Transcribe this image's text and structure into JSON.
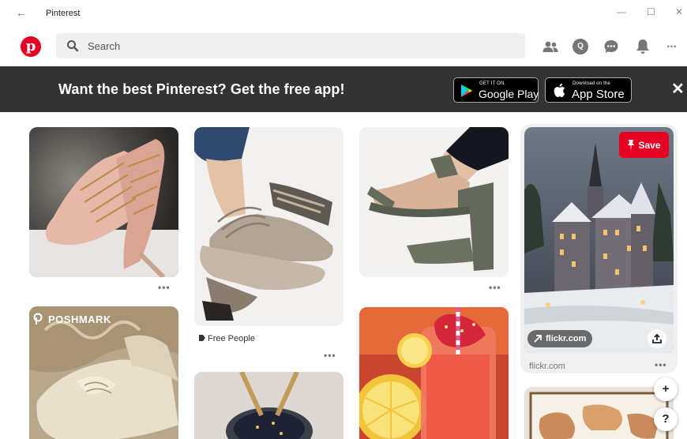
{
  "window": {
    "title": "Pinterest",
    "back_glyph": "←",
    "minimize_glyph": "—",
    "maximize_glyph": "☐",
    "close_glyph": "✕"
  },
  "header": {
    "logo_letter": "p",
    "search": {
      "placeholder": "Search",
      "value": ""
    },
    "notifications_avatar_letter": "Q",
    "more_glyph": "•••"
  },
  "banner": {
    "text": "Want the best Pinterest? Get the free app!",
    "google_play": {
      "small": "GET IT ON",
      "big": "Google Play"
    },
    "app_store": {
      "small": "Download on the",
      "big": "App Store"
    },
    "close_glyph": "✕"
  },
  "pins": {
    "dots": "•••",
    "free_people_label": "Free People",
    "poshmark_label": "POSHMARK",
    "save_label": "Save",
    "link_label": "flickr.com",
    "source_label": "flickr.com"
  },
  "floating": {
    "add_glyph": "+",
    "help_glyph": "?"
  },
  "colors": {
    "brand": "#e60023",
    "banner": "#333333",
    "search_bg": "#efefef"
  }
}
